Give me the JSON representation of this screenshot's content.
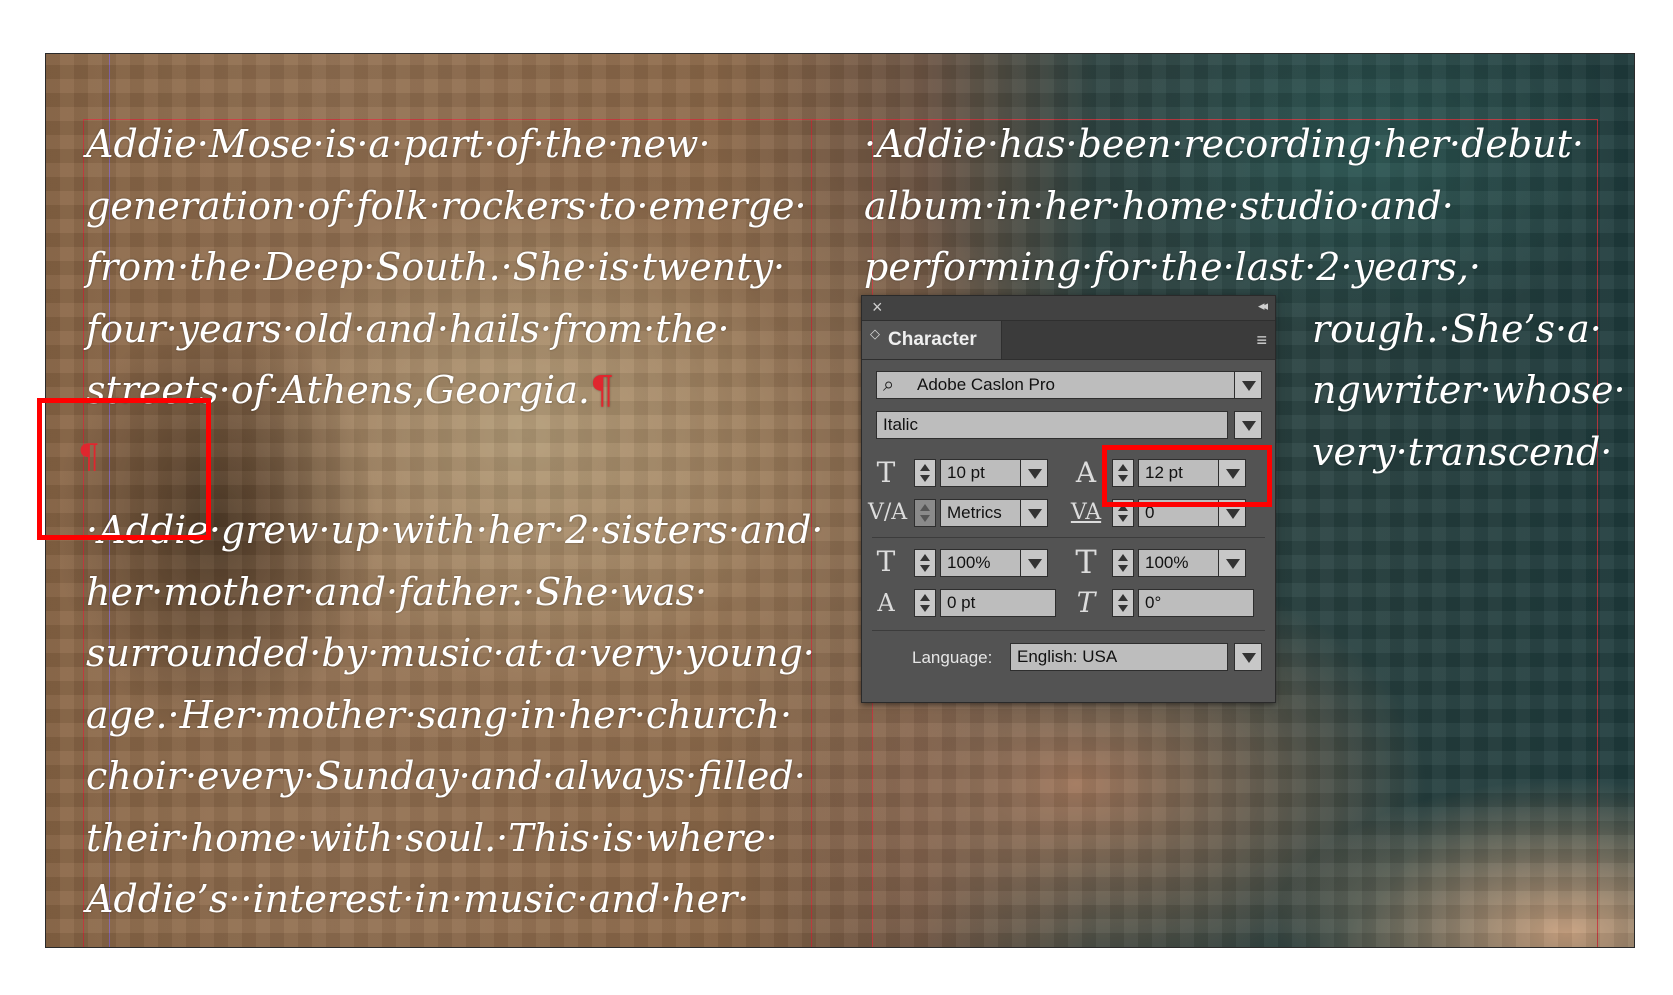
{
  "document": {
    "left_column": [
      "Addie·Mose·is·a·part·of·the·new·",
      "generation·of·folk·rockers·to·emerge·",
      "from·the·Deep·South.·She·is·twenty·",
      "four·years·old·and·hails·from·the·",
      "streets·of·Athens,Georgia."
    ],
    "left_column_2": [
      "·Addie·grew·up·with·her·2·sisters·and·",
      "her·mother·and·father.·She·was·",
      "surrounded·by·music·at·a·very·young·",
      "age.·Her·mother·sang·in·her·church·",
      "choir·every·Sunday·and·always·filled·",
      "their·home·with·soul.·This·is·where·",
      "Addie’s··interest·in·music·and·her·"
    ],
    "right_column": [
      "·Addie·has·been·recording·her·debut·",
      "album·in·her·home·studio·and·",
      "performing·for·the·last·2·years,·",
      "rough.·She’s·a·",
      "ngwriter·whose·",
      "very·transcend·"
    ],
    "pilcrow": "¶"
  },
  "panel": {
    "close": "×",
    "collapse": "◂◂",
    "tab_title": "Character",
    "tab_arrows": "◇",
    "menu": "≡",
    "font_family": "Adobe Caslon Pro",
    "font_style": "Italic",
    "font_size": "10 pt",
    "leading": "12 pt",
    "kerning": "Metrics",
    "tracking": "0",
    "vertical_scale": "100%",
    "horizontal_scale": "100%",
    "baseline_shift": "0 pt",
    "skew": "0°",
    "language_label": "Language:",
    "language": "English: USA"
  },
  "icons": {
    "search": "⌕",
    "size": "T",
    "leading": "A",
    "kerning": "V/A",
    "tracking": "VA",
    "vscale": "T",
    "hscale": "T",
    "baseline": "A",
    "skew": "T"
  }
}
